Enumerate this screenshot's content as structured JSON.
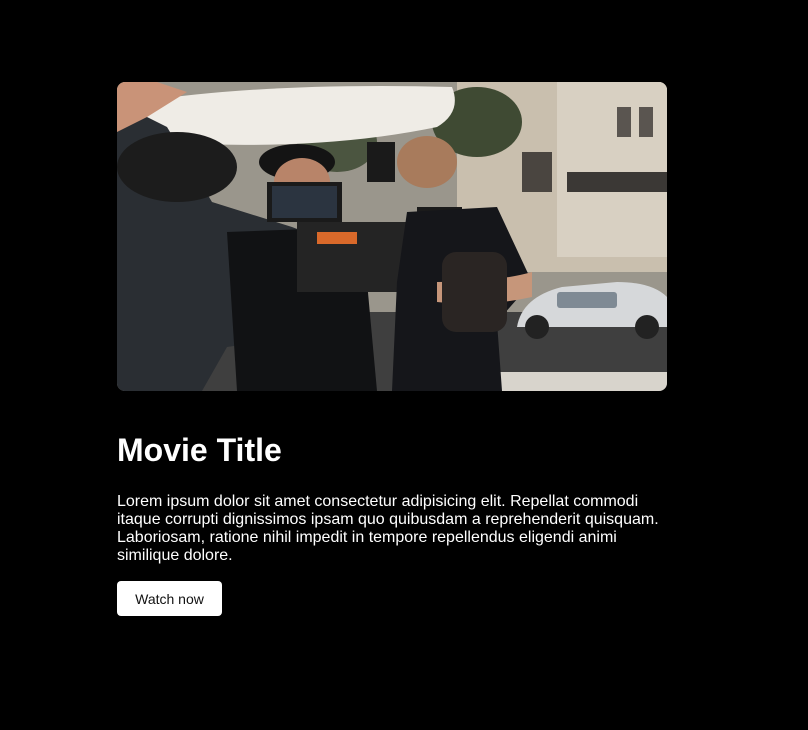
{
  "movie": {
    "title": "Movie Title",
    "description": "Lorem ipsum dolor sit amet consectetur adipisicing elit. Repellat commodi itaque corrupti dignissimos ipsam quo quibusdam a reprehenderit quisquam. Laboriosam, ratione nihil impedit in tempore repellendus eligendi animi similique dolore.",
    "watch_label": "Watch now",
    "image_subject": "film-crew-with-cinema-camera-photo"
  },
  "colors": {
    "background": "#000000",
    "text": "#ffffff",
    "button_bg": "#ffffff",
    "button_text": "#111111"
  }
}
